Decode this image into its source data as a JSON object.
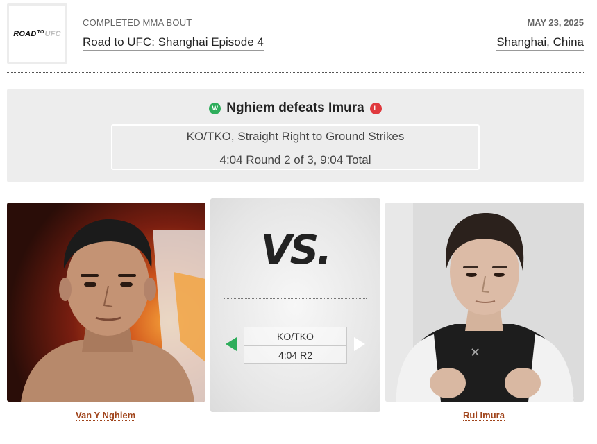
{
  "event": {
    "logo_text_a": "ROAD",
    "logo_text_b": "TO",
    "logo_text_c": "UFC",
    "kicker": "COMPLETED MMA BOUT",
    "name": "Road to UFC: Shanghai Episode 4",
    "date": "MAY 23, 2025",
    "location": "Shanghai, China"
  },
  "result": {
    "winner_badge": "W",
    "headline": "Nghiem defeats Imura",
    "loser_badge": "L",
    "method": "KO/TKO, Straight Right to Ground Strikes",
    "time": "4:04 Round 2 of 3, 9:04 Total"
  },
  "matchup": {
    "vs_label": "VS.",
    "summary_method": "KO/TKO",
    "summary_time": "4:04 R2"
  },
  "fighters": {
    "left": {
      "name": "Van Y Nghiem"
    },
    "right": {
      "name": "Rui Imura"
    }
  },
  "colors": {
    "win": "#2ead5b",
    "loss": "#e0393e",
    "fighter_link": "#a0441b"
  }
}
